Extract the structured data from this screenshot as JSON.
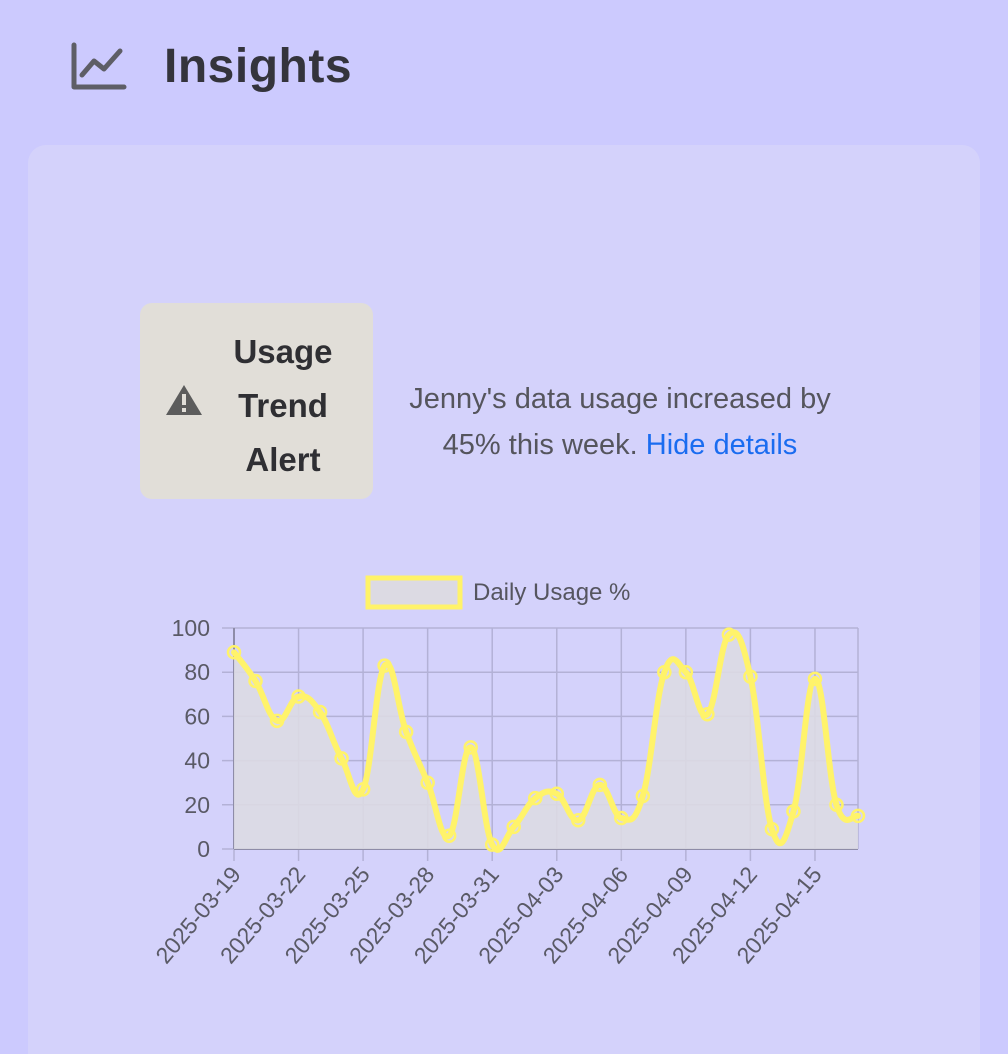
{
  "header": {
    "title": "Insights",
    "icon": "line-chart-icon"
  },
  "alert": {
    "icon": "warning-icon",
    "title_lines": [
      "Usage",
      "Trend",
      "Alert"
    ],
    "message": "Jenny's data usage increased by 45% this week.",
    "link_label": "Hide details"
  },
  "colors": {
    "page_bg": "#cccafe",
    "card_bg": "#d4d2fb",
    "badge_bg": "#e1ded8",
    "series_line": "#fff36a",
    "area_fill": "#dcdae3",
    "link": "#1a6cf0"
  },
  "chart_data": {
    "type": "line",
    "legend": "Daily Usage %",
    "legend_position": "top",
    "grid": true,
    "fill": true,
    "ylim": [
      0,
      100
    ],
    "yticks": [
      0,
      20,
      40,
      60,
      80,
      100
    ],
    "x": [
      "2025-03-19",
      "2025-03-20",
      "2025-03-21",
      "2025-03-22",
      "2025-03-23",
      "2025-03-24",
      "2025-03-25",
      "2025-03-26",
      "2025-03-27",
      "2025-03-28",
      "2025-03-29",
      "2025-03-30",
      "2025-03-31",
      "2025-04-01",
      "2025-04-02",
      "2025-04-03",
      "2025-04-04",
      "2025-04-05",
      "2025-04-06",
      "2025-04-07",
      "2025-04-08",
      "2025-04-09",
      "2025-04-10",
      "2025-04-11",
      "2025-04-12",
      "2025-04-13",
      "2025-04-14",
      "2025-04-15",
      "2025-04-16",
      "2025-04-17"
    ],
    "xtick_labels": [
      "2025-03-19",
      "2025-03-22",
      "2025-03-25",
      "2025-03-28",
      "2025-03-31",
      "2025-04-03",
      "2025-04-06",
      "2025-04-09",
      "2025-04-12",
      "2025-04-15"
    ],
    "series": [
      {
        "name": "Daily Usage %",
        "values": [
          89,
          76,
          58,
          69,
          62,
          41,
          27,
          83,
          53,
          30,
          6,
          46,
          2,
          10,
          23,
          25,
          13,
          29,
          14,
          24,
          80,
          80,
          61,
          97,
          78,
          9,
          17,
          77,
          20,
          15
        ]
      }
    ]
  }
}
